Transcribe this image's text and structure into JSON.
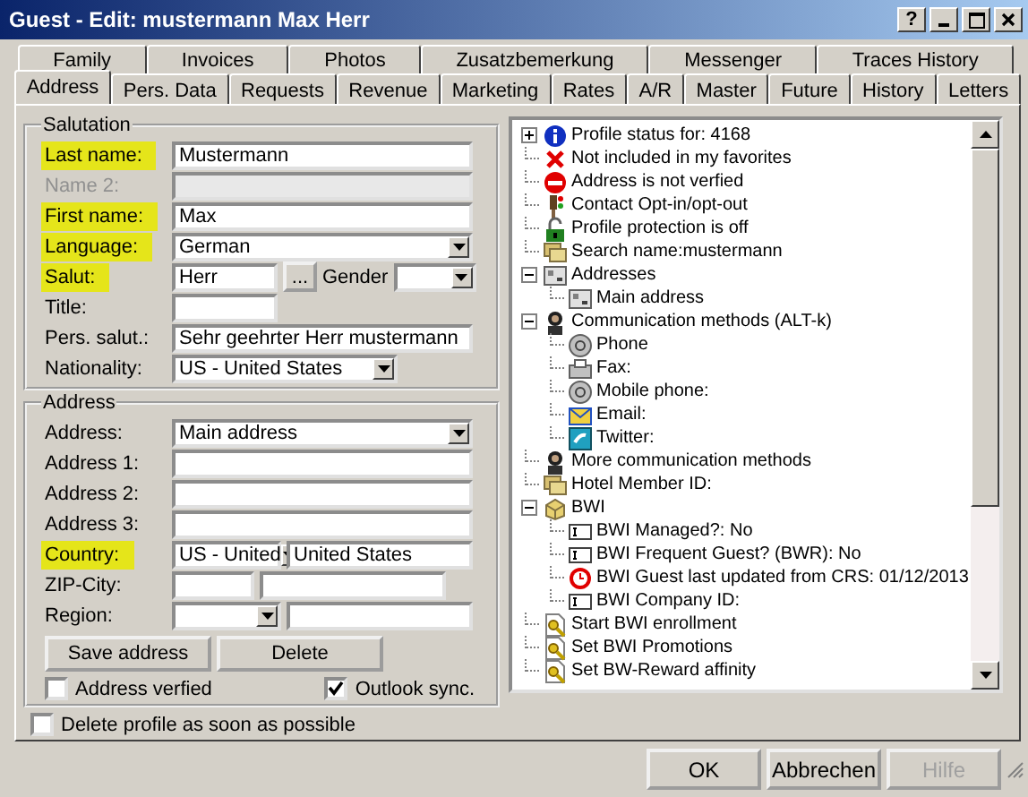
{
  "window": {
    "title": "Guest - Edit: mustermann Max Herr",
    "help_button": "?"
  },
  "tabs": {
    "back_row": [
      {
        "label": "Family",
        "selected": false
      },
      {
        "label": "Invoices",
        "selected": false
      },
      {
        "label": "Photos",
        "selected": false
      },
      {
        "label": "Zusatzbemerkung",
        "selected": false
      },
      {
        "label": "Messenger",
        "selected": false
      },
      {
        "label": "Traces History",
        "selected": false
      }
    ],
    "front_row": [
      {
        "label": "Address",
        "selected": true
      },
      {
        "label": "Pers. Data",
        "selected": false
      },
      {
        "label": "Requests",
        "selected": false
      },
      {
        "label": "Revenue",
        "selected": false
      },
      {
        "label": "Marketing",
        "selected": false
      },
      {
        "label": "Rates",
        "selected": false
      },
      {
        "label": "A/R",
        "selected": false
      },
      {
        "label": "Master",
        "selected": false
      },
      {
        "label": "Future",
        "selected": false
      },
      {
        "label": "History",
        "selected": false
      },
      {
        "label": "Letters",
        "selected": false
      }
    ]
  },
  "salutation": {
    "legend": "Salutation",
    "rows": [
      {
        "kind": "text",
        "label": "Last name:",
        "highlighted": true,
        "disabled": false,
        "value": "Mustermann"
      },
      {
        "kind": "text",
        "label": "Name 2:",
        "highlighted": false,
        "disabled": true
      },
      {
        "kind": "text",
        "label": "First name:",
        "highlighted": true,
        "disabled": false,
        "value": "Max"
      },
      {
        "kind": "select",
        "label": "Language:",
        "highlighted": true,
        "disabled": false,
        "value": "German"
      },
      {
        "kind": "salut",
        "label": "Salut:",
        "highlighted": true,
        "disabled": false,
        "value": "Herr",
        "button": "...",
        "gender_label": "Gender"
      },
      {
        "kind": "short-text",
        "label": "Title:",
        "highlighted": false,
        "disabled": false
      },
      {
        "kind": "text",
        "label": "Pers. salut.:",
        "highlighted": false,
        "disabled": false,
        "value": "Sehr geehrter Herr mustermann"
      },
      {
        "kind": "short-select",
        "label": "Nationality:",
        "highlighted": false,
        "disabled": false,
        "value": "US - United States"
      }
    ]
  },
  "address": {
    "legend": "Address",
    "rows": [
      {
        "kind": "select",
        "label": "Address:",
        "highlighted": false,
        "disabled": false,
        "value": "Main address"
      },
      {
        "kind": "text",
        "label": "Address 1:",
        "highlighted": false,
        "disabled": false
      },
      {
        "kind": "text",
        "label": "Address 2:",
        "highlighted": false,
        "disabled": false
      },
      {
        "kind": "text",
        "label": "Address 3:",
        "highlighted": false,
        "disabled": false
      },
      {
        "kind": "select-text",
        "label": "Country:",
        "highlighted": true,
        "disabled": false,
        "value": "US - United",
        "text_value": "United States"
      },
      {
        "kind": "text-pair",
        "label": "ZIP-City:",
        "highlighted": false,
        "disabled": false
      },
      {
        "kind": "select-text",
        "label": "Region:",
        "highlighted": false,
        "disabled": false
      }
    ],
    "buttons": [
      "Save address",
      "Delete"
    ],
    "checkboxes": [
      {
        "label": "Address verfied",
        "checked": false
      },
      {
        "label": "Outlook sync.",
        "checked": true
      }
    ]
  },
  "delete_profile": {
    "label": "Delete profile as soon as possible",
    "checked": false
  },
  "tree": [
    {
      "label": "Profile status for: 4168",
      "kind": "info",
      "expanded": false
    },
    {
      "label": "Not included in my favorites",
      "kind": "cross"
    },
    {
      "label": "Address is not verfied",
      "kind": "no-entry"
    },
    {
      "label": "Contact Opt-in/opt-out",
      "kind": "traffic-light"
    },
    {
      "label": "Profile protection is off",
      "kind": "padlock"
    },
    {
      "label": "Search name:mustermann",
      "kind": "cards"
    },
    {
      "label": "Addresses",
      "kind": "address-card",
      "expanded": true,
      "children": [
        {
          "label": "Main address",
          "kind": "address-card"
        }
      ]
    },
    {
      "label": "Communication methods (ALT-k)",
      "kind": "person",
      "expanded": true,
      "children": [
        {
          "label": "Phone",
          "kind": "phone"
        },
        {
          "label": "Fax:",
          "kind": "fax"
        },
        {
          "label": "Mobile phone:",
          "kind": "phone"
        },
        {
          "label": "Email:",
          "kind": "envelope"
        },
        {
          "label": "Twitter:",
          "kind": "bird"
        }
      ]
    },
    {
      "label": "More communication methods",
      "kind": "person"
    },
    {
      "label": "Hotel Member ID:",
      "kind": "cards"
    },
    {
      "label": "BWI",
      "kind": "box",
      "expanded": true,
      "children": [
        {
          "label": "BWI Managed?: No",
          "kind": "text-field"
        },
        {
          "label": "BWI Frequent Guest? (BWR): No",
          "kind": "text-field"
        },
        {
          "label": "BWI Guest last updated from CRS: 01/12/2013",
          "kind": "clock"
        },
        {
          "label": "BWI Company ID:",
          "kind": "text-field"
        }
      ]
    },
    {
      "label": "Start BWI enrollment",
      "kind": "document-key"
    },
    {
      "label": "Set BWI Promotions",
      "kind": "document-key"
    },
    {
      "label": "Set BW-Reward affinity",
      "kind": "document-key"
    }
  ],
  "buttons": [
    {
      "label": "OK",
      "disabled": false
    },
    {
      "label": "Abbrechen",
      "disabled": false
    },
    {
      "label": "Hilfe",
      "disabled": true
    }
  ]
}
